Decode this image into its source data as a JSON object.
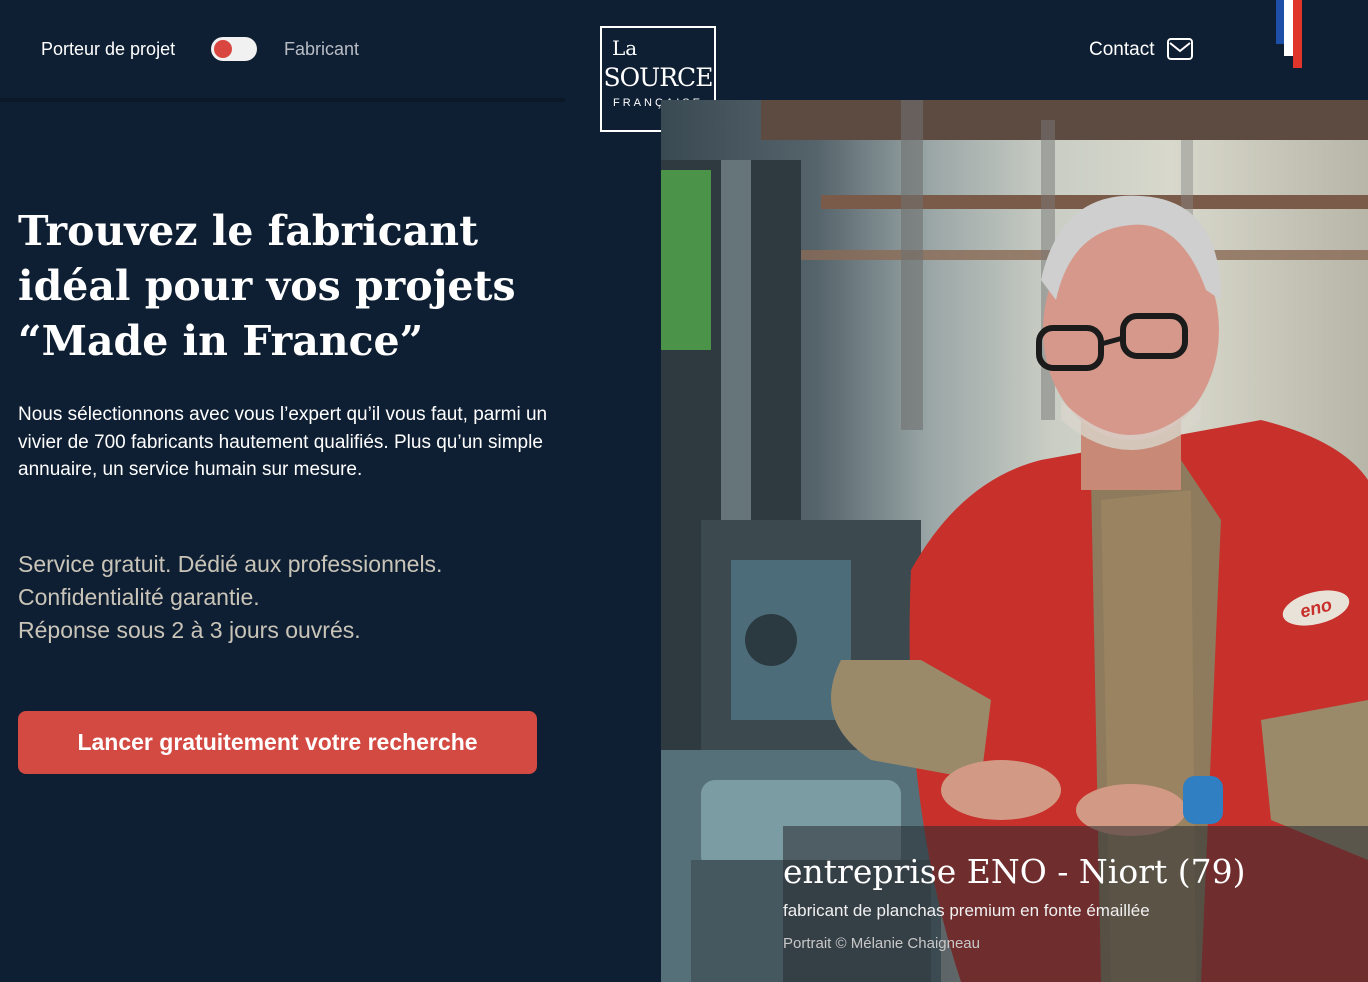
{
  "header": {
    "role_left": "Porteur de projet",
    "role_right": "Fabricant",
    "contact_label": "Contact",
    "logo": {
      "la": "La",
      "source": "SOURCE",
      "francaise": "FRANÇAISE"
    },
    "toggle_state": "porteur-de-projet"
  },
  "hero": {
    "headline_lines": [
      "Trouvez le fabricant",
      "idéal pour vos projets",
      "“Made in France”"
    ],
    "intro": "Nous sélectionnons avec vous l’expert qu’il vous faut, parmi un vivier de 700 fabricants hautement qualifiés. Plus qu’un simple annuaire, un service humain sur mesure.",
    "features": [
      "Service gratuit. Dédié aux professionnels.",
      "Confidentialité garantie.",
      "Réponse sous 2 à 3 jours ouvrés."
    ],
    "cta_label": "Lancer gratuitement votre recherche"
  },
  "photo": {
    "caption_title": "entreprise ENO - Niort (79)",
    "caption_subtitle": "fabricant de planchas premium en fonte émaillée",
    "caption_credit": "Portrait © Mélanie Chaigneau",
    "badge_text": "eno"
  },
  "colors": {
    "background": "#0f1f33",
    "accent": "#d34a43",
    "muted_text": "#c9c4b8"
  }
}
